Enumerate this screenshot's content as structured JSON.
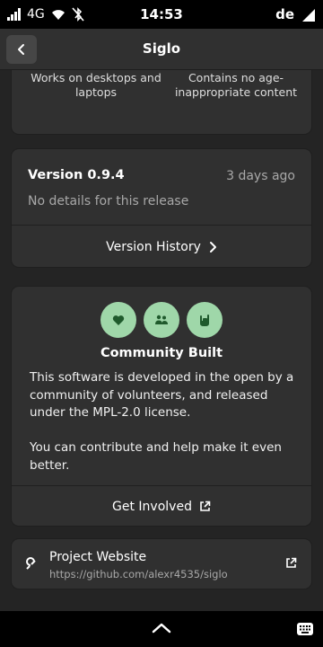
{
  "status_bar": {
    "network": "4G",
    "time": "14:53",
    "keyboard_layout": "de",
    "icons": [
      "signal-icon",
      "wifi-icon",
      "bluetooth-off-icon",
      "battery-icon"
    ]
  },
  "header": {
    "title": "Siglo",
    "back_icon": "chevron-left-icon"
  },
  "compatibility": {
    "device_support": "Works on desktops and laptops",
    "age_rating": "Contains no age-inappropriate content"
  },
  "version": {
    "title": "Version 0.9.4",
    "date": "3 days ago",
    "details": "No details for this release",
    "history_label": "Version History"
  },
  "community": {
    "badge_icons": [
      "heart-icon",
      "people-icon",
      "hand-icon"
    ],
    "badge_color": "#9fd7a9",
    "title": "Community Built",
    "paragraph1": "This software is developed in the open by a community of volunteers, and released under the MPL-2.0 license.",
    "paragraph2": "You can contribute and help make it even better.",
    "get_involved_label": "Get Involved"
  },
  "website": {
    "title": "Project Website",
    "url": "https://github.com/alexr4535/siglo"
  },
  "colors": {
    "background": "#242424",
    "card": "#303030",
    "secondary_text": "#a8a8a8"
  }
}
